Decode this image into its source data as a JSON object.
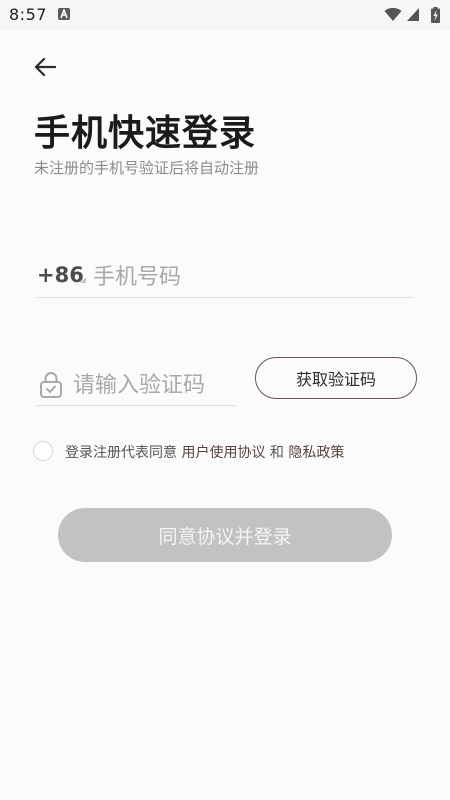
{
  "status_bar": {
    "time": "8:57",
    "app_icon": "a-notification-icon",
    "icons": [
      "wifi-icon",
      "signal-icon",
      "battery-charging-icon"
    ]
  },
  "header": {
    "back_icon": "arrow-left-icon",
    "title": "手机快速登录",
    "subtitle": "未注册的手机号验证后将自动注册"
  },
  "phone": {
    "country_code": "+86",
    "placeholder": "手机号码",
    "value": ""
  },
  "code": {
    "lock_icon": "lock-icon",
    "placeholder": "请输入验证码",
    "value": "",
    "get_code_label": "获取验证码"
  },
  "agreement": {
    "prefix": "登录注册代表同意 ",
    "user_agreement": "用户使用协议",
    "and": " 和 ",
    "privacy_policy": "隐私政策",
    "checked": false
  },
  "login_button": {
    "label": "同意协议并登录",
    "enabled": false
  },
  "colors": {
    "background": "#fcfbfb",
    "accent_border": "#6e5550",
    "disabled_button": "#c2c2c2",
    "link": "#5a4440"
  }
}
